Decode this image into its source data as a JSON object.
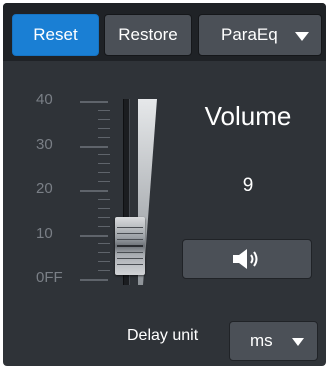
{
  "toolbar": {
    "reset_label": "Reset",
    "restore_label": "Restore",
    "mode_value": "ParaEq"
  },
  "fader": {
    "scale_labels": [
      "40",
      "30",
      "20",
      "10",
      "0FF"
    ],
    "level_fraction": 0.2
  },
  "volume": {
    "title": "Volume",
    "value": "9",
    "mute_icon": "speaker-icon"
  },
  "delay": {
    "label": "Delay unit",
    "value": "ms"
  },
  "colors": {
    "accent": "#1a7fd4",
    "panel_bg": "#2f3338",
    "toolbar_bg": "#1f2226",
    "button_bg": "#4b5057"
  }
}
